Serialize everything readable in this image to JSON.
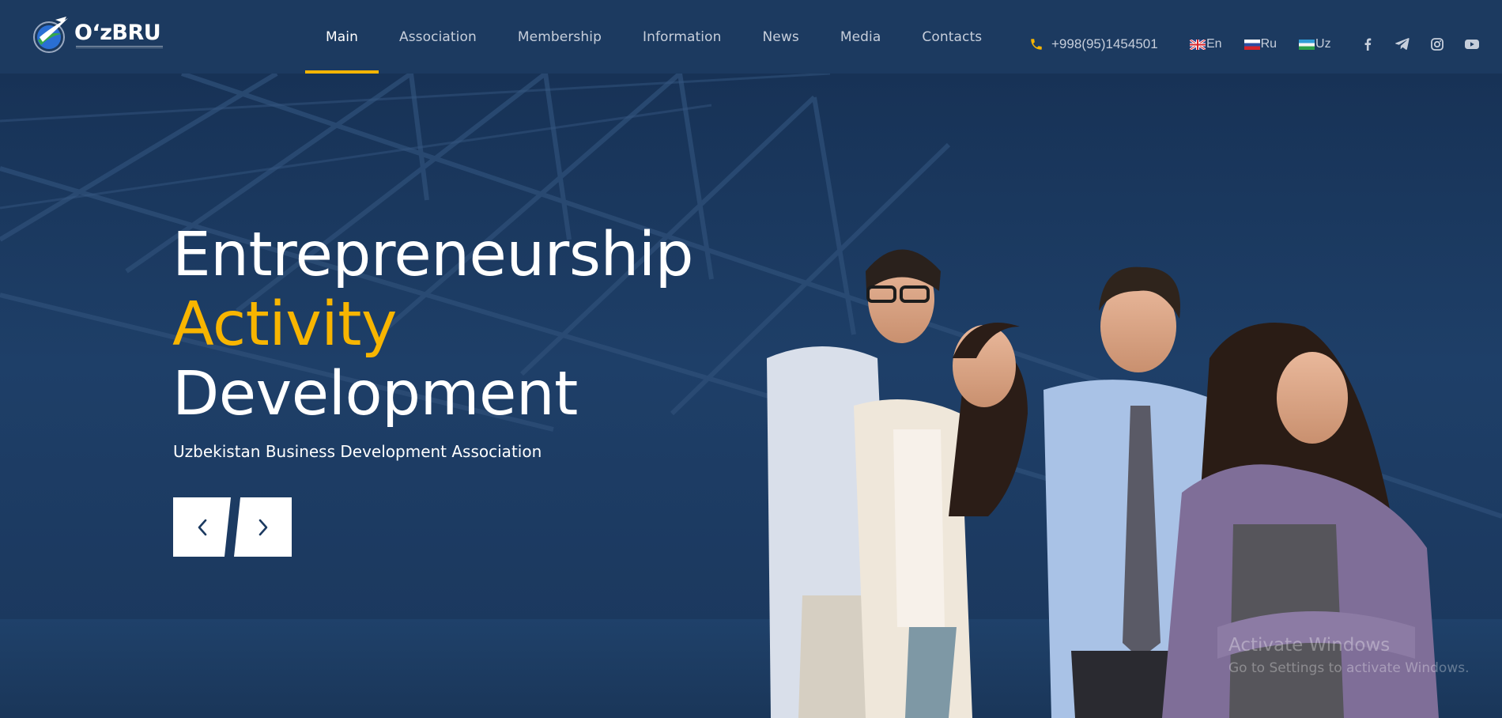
{
  "brand": {
    "name": "O‘zBRU"
  },
  "nav": {
    "items": [
      {
        "label": "Main",
        "active": true
      },
      {
        "label": "Association"
      },
      {
        "label": "Membership"
      },
      {
        "label": "Information"
      },
      {
        "label": "News"
      },
      {
        "label": "Media"
      },
      {
        "label": "Contacts"
      }
    ]
  },
  "contact": {
    "phone": "+998(95)1454501"
  },
  "languages": [
    {
      "code": "en",
      "label": "En"
    },
    {
      "code": "ru",
      "label": "Ru"
    },
    {
      "code": "uz",
      "label": "Uz"
    }
  ],
  "socials": [
    "facebook-icon",
    "telegram-icon",
    "instagram-icon",
    "youtube-icon"
  ],
  "hero": {
    "line1": "Entrepreneurship",
    "line2": "Activity",
    "line3": "Development",
    "subtitle": "Uzbekistan Business Development Association",
    "prev_icon": "chevron-left-icon",
    "next_icon": "chevron-right-icon"
  },
  "watermark": {
    "title": "Activate Windows",
    "message": "Go to Settings to activate Windows."
  },
  "colors": {
    "header_bg": "#1c3a60",
    "hero_bg": "#1e3f68",
    "accent": "#f8b500",
    "nav_text": "#c6cedb",
    "white": "#ffffff"
  }
}
